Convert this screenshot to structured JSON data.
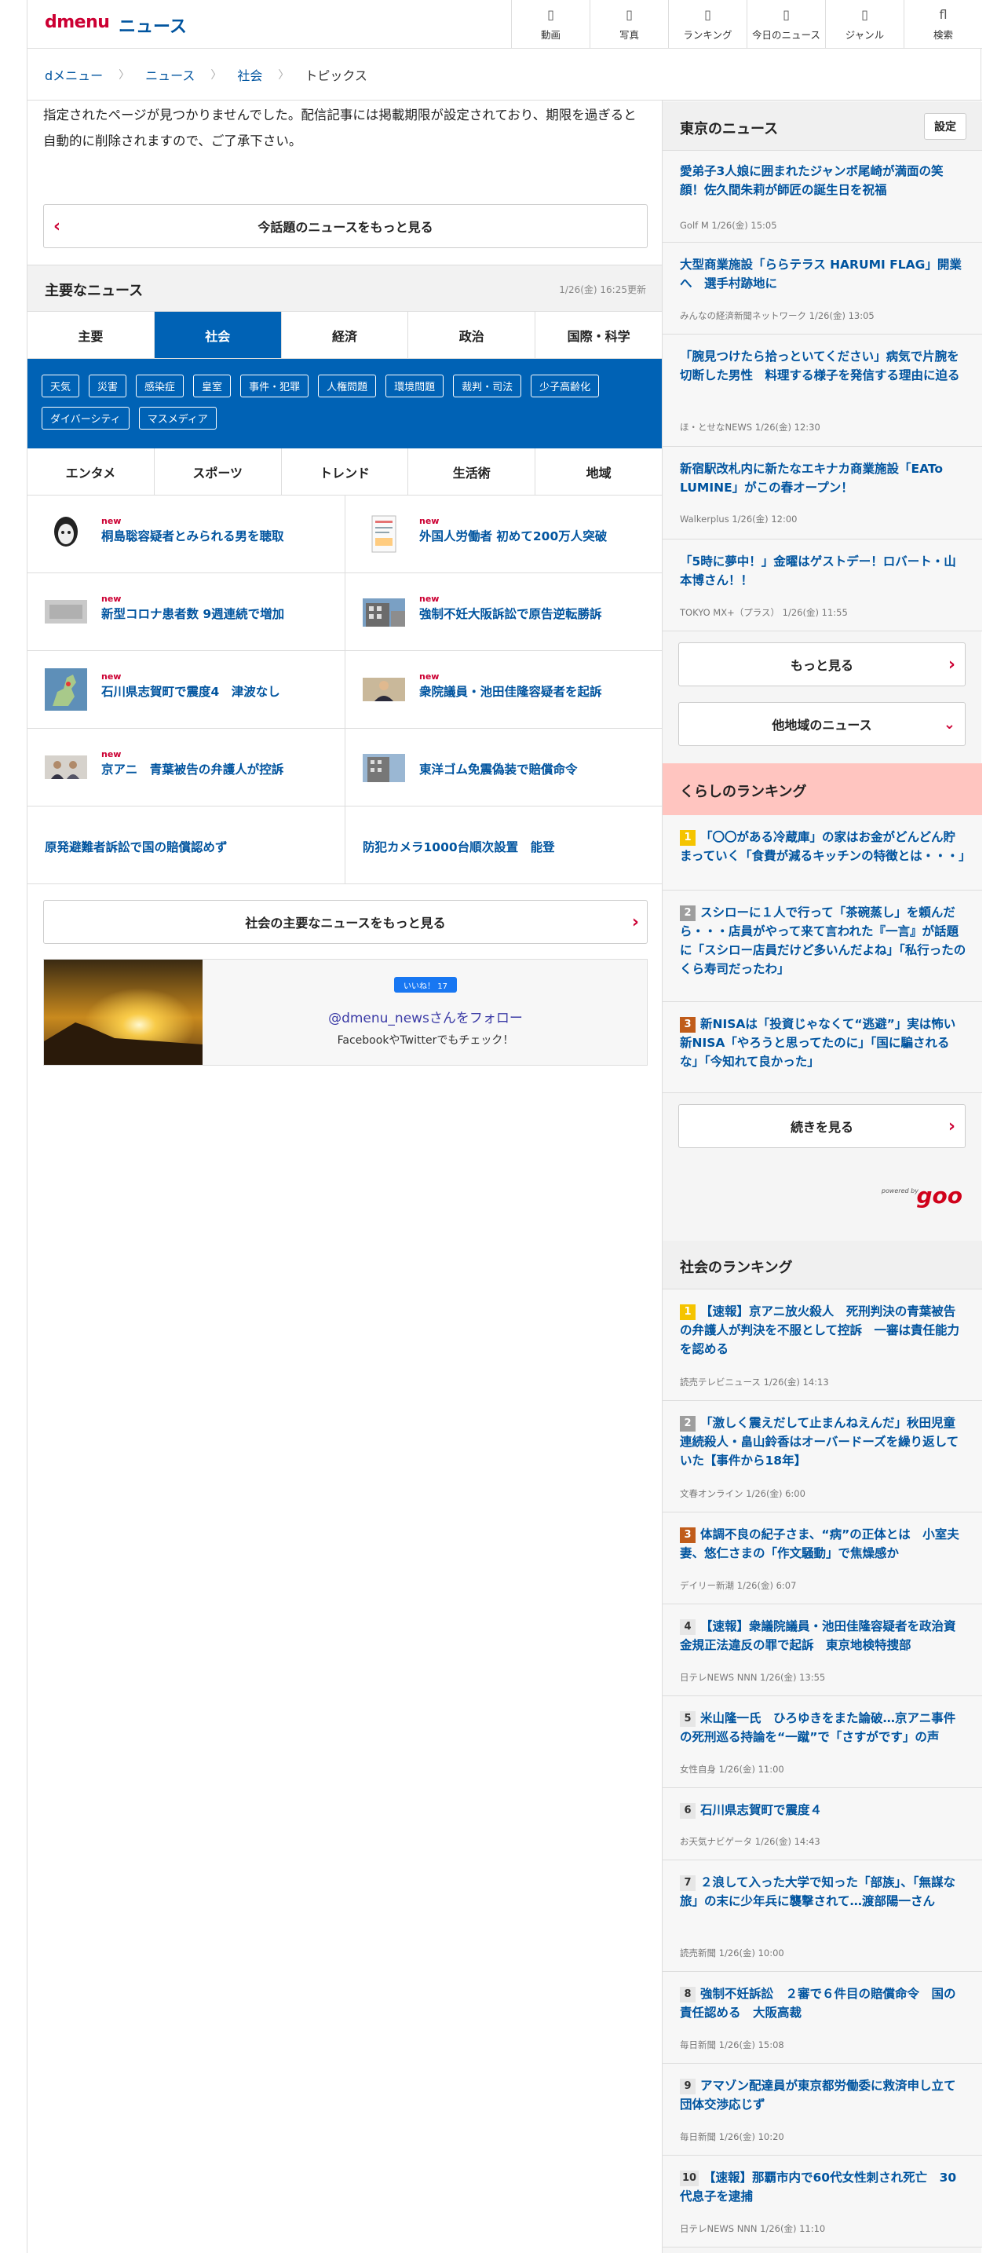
{
  "header": {
    "logo": "dmenu",
    "title": "ニュース",
    "nav": [
      {
        "icon": "video-icon",
        "glyph": "▯",
        "label": "動画"
      },
      {
        "icon": "photo-icon",
        "glyph": "▯",
        "label": "写真"
      },
      {
        "icon": "ranking-icon",
        "glyph": "▯",
        "label": "ランキング"
      },
      {
        "icon": "today-icon",
        "glyph": "▯",
        "label": "今日のニュース"
      },
      {
        "icon": "genre-icon",
        "glyph": "▯",
        "label": "ジャンル"
      },
      {
        "icon": "search-icon",
        "glyph": "fl",
        "label": "検索"
      }
    ]
  },
  "breadcrumb": [
    "dメニュー",
    "ニュース",
    "社会",
    "トピックス"
  ],
  "notice": "指定されたページが見つかりませんでした。配信記事には掲載期限が設定されており、期限を過ぎると自動的に削除されますので、ご了承下さい。",
  "topics_more": "今話題のニュースをもっと見る",
  "major": {
    "title": "主要なニュース",
    "updated": "1/26(金) 16:25更新",
    "tabs1": [
      "主要",
      "社会",
      "経済",
      "政治",
      "国際・科学"
    ],
    "active_tab": "社会",
    "tags": [
      "天気",
      "災害",
      "感染症",
      "皇室",
      "事件・犯罪",
      "人権問題",
      "環境問題",
      "裁判・司法",
      "少子高齢化",
      "ダイバーシティ",
      "マスメディア"
    ],
    "tabs2": [
      "エンタメ",
      "スポーツ",
      "トレンド",
      "生活術",
      "地域"
    ],
    "new_label": "new",
    "items": [
      {
        "title": "桐島聡容疑者とみられる男を聴取",
        "new": true,
        "thumb": "portrait"
      },
      {
        "title": "外国人労働者 初めて200万人突破",
        "new": true,
        "thumb": "document"
      },
      {
        "title": "新型コロナ患者数 9週連続で増加",
        "new": true,
        "thumb": "gray"
      },
      {
        "title": "強制不妊大阪訴訟で原告逆転勝訴",
        "new": true,
        "thumb": "building"
      },
      {
        "title": "石川県志賀町で震度4　津波なし",
        "new": true,
        "thumb": "map"
      },
      {
        "title": "衆院議員・池田佳隆容疑者を起訴",
        "new": true,
        "thumb": "person"
      },
      {
        "title": "京アニ　青葉被告の弁護人が控訴",
        "new": true,
        "thumb": "people"
      },
      {
        "title": "東洋ゴム免震偽装で賠償命令",
        "new": false,
        "thumb": "building"
      },
      {
        "title": "原発避難者訴訟で国の賠償認めず",
        "new": false,
        "thumb": ""
      },
      {
        "title": "防犯カメラ1000台順次設置　能登",
        "new": false,
        "thumb": ""
      }
    ],
    "more": "社会の主要なニュースをもっと見る"
  },
  "follow": {
    "like": "いいね！ 17",
    "account": "@dmenu_newsさんをフォロー",
    "sub": "FacebookやTwitterでもチェック！"
  },
  "tokyo": {
    "title": "東京のニュース",
    "settings": "設定",
    "items": [
      {
        "title": "愛弟子3人娘に囲まれたジャンボ尾崎が満面の笑顔！佐久間朱莉が師匠の誕生日を祝福",
        "source": "Golf M  1/26(金) 15:05"
      },
      {
        "title": "大型商業施設「ららテラス HARUMI FLAG」開業へ　選手村跡地に",
        "source": "みんなの経済新聞ネットワーク  1/26(金) 13:05"
      },
      {
        "title": "「腕見つけたら拾っといてください」病気で片腕を切断した男性　料理する様子を発信する理由に迫る",
        "source": "ほ・とせなNEWS  1/26(金) 12:30"
      },
      {
        "title": "新宿駅改札内に新たなエキナカ商業施設「EATo LUMINE」がこの春オープン！",
        "source": "Walkerplus  1/26(金) 12:00"
      },
      {
        "title": "「5時に夢中！」金曜はゲストデー！ロバート・山本博さん！！",
        "source": "TOKYO MX+（プラス）  1/26(金) 11:55"
      }
    ],
    "more": "もっと見る",
    "other": "他地域のニュース"
  },
  "kurashi": {
    "title": "くらしのランキング",
    "items": [
      {
        "rank": "1",
        "title": "「〇〇がある冷蔵庫」の家はお金がどんどん貯まっていく「食費が減るキッチンの特徴とは・・・」"
      },
      {
        "rank": "2",
        "title": "スシローに１人で行って「茶碗蒸し」を頼んだら・・・店員がやって来て言われた『一言』が話題に「スシロー店員だけど多いんだよね」「私行ったのくら寿司だったわ」"
      },
      {
        "rank": "3",
        "title": "新NISAは「投資じゃなくて“逃避”」実は怖い新NISA「やろうと思ってたのに」「国に騙される な」「今知れて良かった」"
      }
    ],
    "more": "続きを見る",
    "powered": "powered by",
    "brand": "goo"
  },
  "shakai_ranking": {
    "title": "社会のランキング",
    "items": [
      {
        "rank": "1",
        "title": "【速報】京アニ放火殺人　死刑判決の青葉被告の弁護人が判決を不服として控訴　一審は責任能力を認める",
        "source": "読売テレビニュース  1/26(金) 14:13"
      },
      {
        "rank": "2",
        "title": "「激しく震えだして止まんねえんだ」秋田児童連続殺人・畠山鈴香はオーバードーズを繰り返していた【事件から18年】",
        "source": "文春オンライン  1/26(金) 6:00"
      },
      {
        "rank": "3",
        "title": "体調不良の紀子さま、“病”の正体とは　小室夫妻、悠仁さまの「作文騒動」で焦燥感か",
        "source": "デイリー新潮  1/26(金) 6:07"
      },
      {
        "rank": "4",
        "title": "【速報】衆議院議員・池田佳隆容疑者を政治資金規正法違反の罪で起訴　東京地検特捜部",
        "source": "日テレNEWS NNN  1/26(金) 13:55"
      },
      {
        "rank": "5",
        "title": "米山隆一氏　ひろゆきをまた論破…京アニ事件の死刑巡る持論を“一蹴”で「さすがです」の声",
        "source": "女性自身  1/26(金) 11:00"
      },
      {
        "rank": "6",
        "title": "石川県志賀町で震度４",
        "source": "お天気ナビゲータ  1/26(金) 14:43"
      },
      {
        "rank": "7",
        "title": "２浪して入った大学で知った「部族」、「無謀な旅」の末に少年兵に襲撃されて…渡部陽一さん",
        "source": "読売新聞  1/26(金) 10:00"
      },
      {
        "rank": "8",
        "title": "強制不妊訴訟　２審で６件目の賠償命令　国の責任認める　大阪高裁",
        "source": "毎日新聞  1/26(金) 15:08"
      },
      {
        "rank": "9",
        "title": "アマゾン配達員が東京都労働委に救済申し立て　団体交渉応じず",
        "source": "毎日新聞  1/26(金) 10:20"
      },
      {
        "rank": "10",
        "title": "【速報】那覇市内で60代女性刺され死亡　30代息子を逮捕",
        "source": "日テレNEWS NNN  1/26(金) 11:10"
      }
    ]
  }
}
